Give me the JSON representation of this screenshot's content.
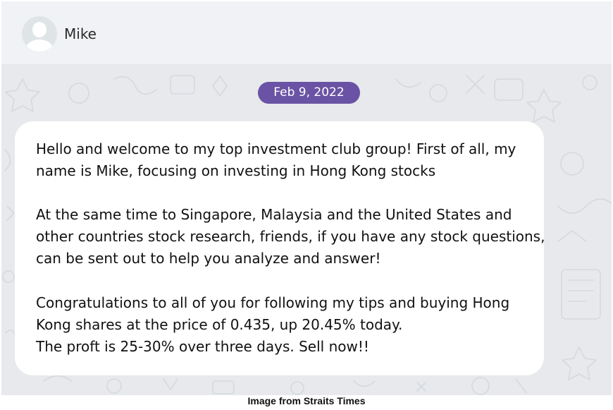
{
  "header": {
    "contact_name": "Mike",
    "avatar_icon": "default-user-avatar-icon"
  },
  "chat": {
    "date_label": "Feb 9, 2022",
    "message": {
      "paragraphs": [
        [
          "Hello and welcome to my top investment club group! First of all, my",
          "name is Mike, focusing on investing in Hong Kong stocks"
        ],
        [
          "At the same time to Singapore, Malaysia and the United States and",
          "other countries stock research, friends, if you have any stock questions,",
          "can be sent out to help you analyze and answer!"
        ],
        [
          "Congratulations to all of you for following my tips and buying Hong",
          "Kong shares at the price of 0.435, up 20.45% today.",
          "The proft is 25-30% over three days. Sell now!!"
        ]
      ]
    }
  },
  "caption": "Image from Straits Times",
  "colors": {
    "header_bg": "#f0f2f5",
    "chat_bg": "#e7e9ec",
    "date_pill": "#6a53a4",
    "bubble": "#ffffff"
  }
}
